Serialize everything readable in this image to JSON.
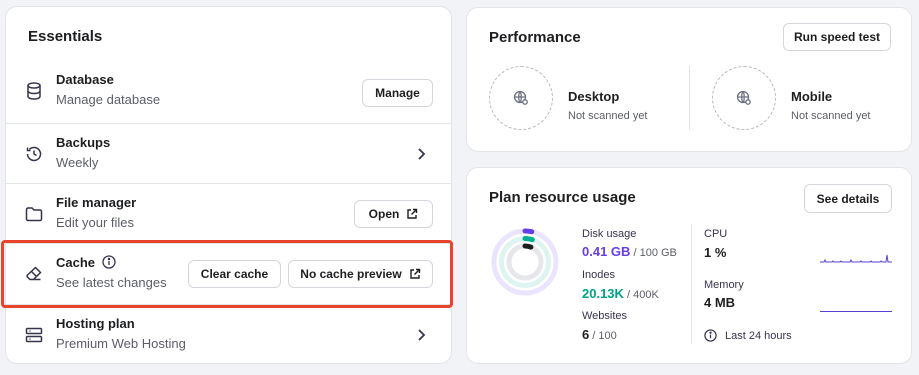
{
  "essentials": {
    "title": "Essentials",
    "items": [
      {
        "title": "Database",
        "subtitle": "Manage database",
        "action": "Manage"
      },
      {
        "title": "Backups",
        "subtitle": "Weekly"
      },
      {
        "title": "File manager",
        "subtitle": "Edit your files",
        "action": "Open"
      },
      {
        "title": "Cache",
        "subtitle": "See latest changes",
        "action_primary": "Clear cache",
        "action_secondary": "No cache preview"
      },
      {
        "title": "Hosting plan",
        "subtitle": "Premium Web Hosting"
      }
    ]
  },
  "performance": {
    "title": "Performance",
    "run_button": "Run speed test",
    "desktop": {
      "label": "Desktop",
      "status": "Not scanned yet"
    },
    "mobile": {
      "label": "Mobile",
      "status": "Not scanned yet"
    }
  },
  "plan": {
    "title": "Plan resource usage",
    "details_button": "See details",
    "disk": {
      "label": "Disk usage",
      "value": "0.41 GB",
      "total": " / 100 GB",
      "fraction": 0.0041
    },
    "inodes": {
      "label": "Inodes",
      "value": "20.13K",
      "total": " / 400K",
      "fraction": 0.0503
    },
    "websites": {
      "label": "Websites",
      "value": "6",
      "total": " / 100",
      "fraction": 0.06
    },
    "cpu": {
      "label": "CPU",
      "value": "1 %"
    },
    "memory": {
      "label": "Memory",
      "value": "4 MB"
    },
    "period": "Last 24 hours"
  },
  "colors": {
    "accent": "#673de6",
    "disk": "#673de6",
    "inodes": "#00b090",
    "websites": "#1d1e20",
    "highlight": "#e8452c"
  }
}
